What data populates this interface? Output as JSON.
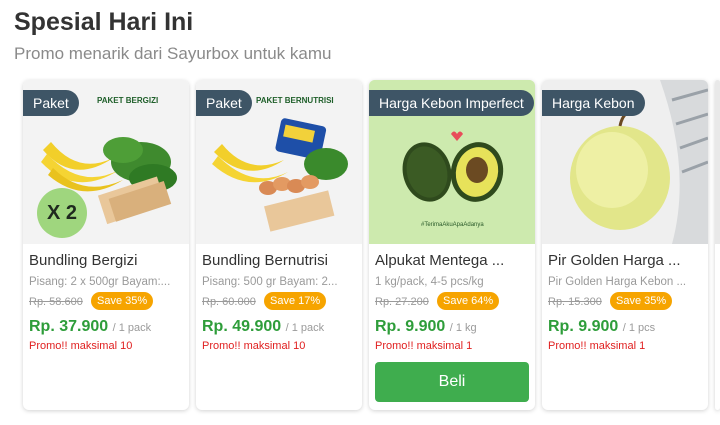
{
  "header": {
    "title": "Spesial Hari Ini",
    "subtitle": "Promo menarik dari Sayurbox untuk kamu"
  },
  "cards": [
    {
      "badge": "Paket",
      "image_text": "PAKET BERGIZI",
      "multiplier": "X 2",
      "name": "Bundling Bergizi",
      "desc": "Pisang: 2 x 500gr Bayam:...",
      "old_price": "Rp. 58.600",
      "save": "Save 35%",
      "price": "Rp. 37.900",
      "unit": "/ 1 pack",
      "promo": "Promo!! maksimal 10"
    },
    {
      "badge": "Paket",
      "image_text": "PAKET BERNUTRISI",
      "name": "Bundling Bernutrisi",
      "desc": "Pisang: 500 gr Bayam: 2...",
      "old_price": "Rp. 60.000",
      "save": "Save 17%",
      "price": "Rp. 49.900",
      "unit": "/ 1 pack",
      "promo": "Promo!! maksimal 10"
    },
    {
      "badge": "Harga Kebon Imperfect",
      "image_text": "#TerimaAkuApaAdanya",
      "name": "Alpukat Mentega ...",
      "desc": "1 kg/pack, 4-5 pcs/kg",
      "old_price": "Rp. 27.200",
      "save": "Save 64%",
      "price": "Rp. 9.900",
      "unit": "/ 1 kg",
      "promo": "Promo!! maksimal 1",
      "button": "Beli"
    },
    {
      "badge": "Harga Kebon",
      "name": "Pir Golden Harga ...",
      "desc": "Pir Golden Harga Kebon ...",
      "old_price": "Rp. 15.300",
      "save": "Save 35%",
      "price": "Rp. 9.900",
      "unit": "/ 1 pcs",
      "promo": "Promo!! maksimal 1"
    }
  ],
  "colors": {
    "badge_bg": "#3e5566",
    "save_bg": "#f6a400",
    "price": "#2e9d3a",
    "promo": "#e02020",
    "button": "#3fad4e"
  }
}
